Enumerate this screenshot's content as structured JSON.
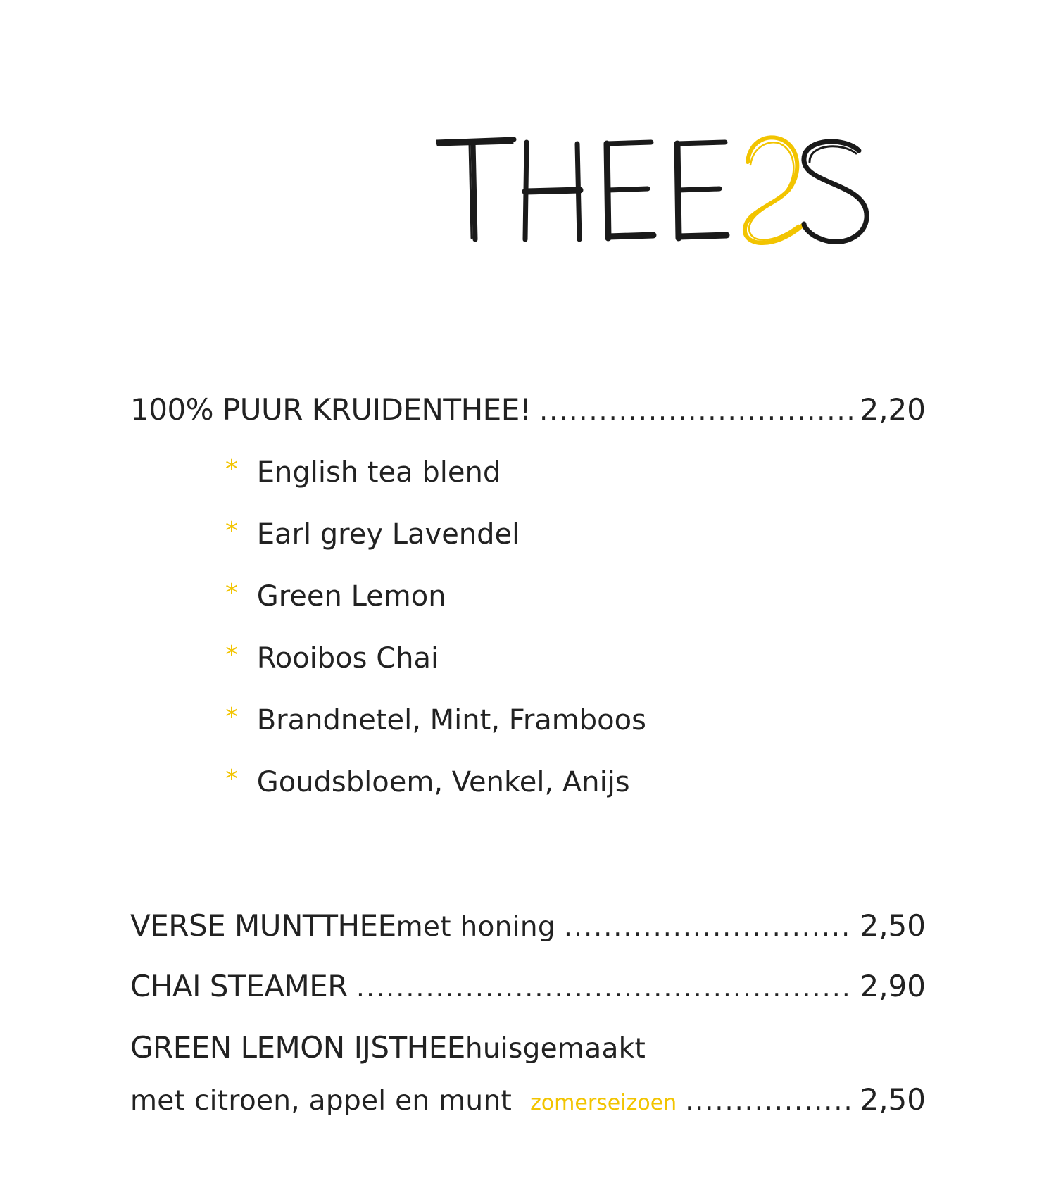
{
  "title": {
    "text": "THEEES",
    "letters_dark": [
      "T",
      "H",
      "E",
      "E"
    ],
    "letter_accent": "S",
    "letter_last": "S",
    "dark_color": "#1a1a1a",
    "accent_color": "#f2c400"
  },
  "colors": {
    "text": "#222222",
    "accent": "#f2c400"
  },
  "menu": {
    "kruidenthee": {
      "name": "100% PUUR KRUIDENTHEE!",
      "price": "2,20",
      "flavours": [
        "English tea blend",
        "Earl grey Lavendel",
        "Green Lemon",
        "Rooibos Chai",
        "Brandnetel, Mint, Framboos",
        "Goudsbloem, Venkel, Anijs"
      ],
      "bullet": "*"
    },
    "muntthee": {
      "name": "VERSE MUNTTHEE",
      "extra": " met honing",
      "price": "2,50"
    },
    "chai": {
      "name": "CHAI STEAMER",
      "price": "2,90"
    },
    "ijsthee": {
      "name": "GREEN LEMON IJSTHEE",
      "extra": " huisgemaakt",
      "line2": "met citroen, appel en munt",
      "season": "zomerseizoen",
      "price": "2,50"
    }
  }
}
